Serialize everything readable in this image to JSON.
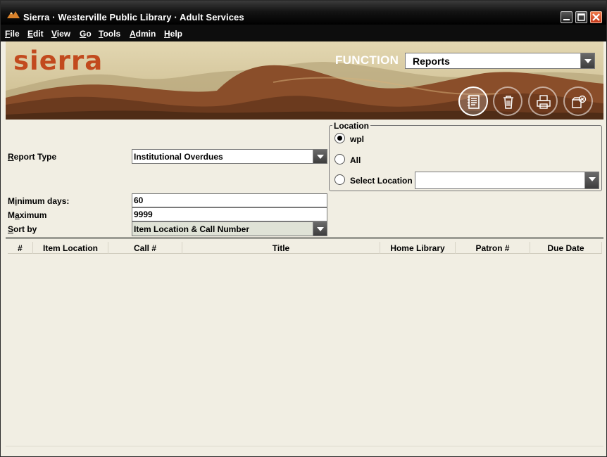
{
  "window": {
    "title": "Sierra · Westerville Public Library · Adult Services"
  },
  "menu": [
    {
      "label": "File",
      "mnemonic": "F",
      "rest": "ile"
    },
    {
      "label": "Edit",
      "mnemonic": "E",
      "rest": "dit"
    },
    {
      "label": "View",
      "mnemonic": "V",
      "rest": "iew"
    },
    {
      "label": "Go",
      "mnemonic": "G",
      "rest": "o"
    },
    {
      "label": "Tools",
      "mnemonic": "T",
      "rest": "ools"
    },
    {
      "label": "Admin",
      "mnemonic": "A",
      "rest": "dmin"
    },
    {
      "label": "Help",
      "mnemonic": "H",
      "rest": "elp"
    }
  ],
  "banner": {
    "logo": "sierra",
    "function_label": "FUNCTION",
    "function_value": "Reports",
    "tools": [
      "report-icon",
      "trash-icon",
      "print-icon",
      "close-record-icon"
    ]
  },
  "form": {
    "report_type": {
      "mnemonic": "R",
      "rest": "eport Type",
      "value": "Institutional Overdues"
    },
    "minimum_days": {
      "pre": "M",
      "mnemonic": "i",
      "rest": "nimum days:",
      "value": "60"
    },
    "maximum": {
      "pre": "M",
      "mnemonic": "a",
      "rest": "ximum",
      "value": "9999"
    },
    "sort_by": {
      "mnemonic": "S",
      "rest": "ort by",
      "value": "Item Location & Call Number"
    }
  },
  "location": {
    "legend": "Location",
    "options": [
      {
        "label": "wpl",
        "checked": true
      },
      {
        "label": "All",
        "checked": false
      },
      {
        "label": "Select Location",
        "checked": false
      }
    ],
    "select_value": ""
  },
  "table": {
    "columns": [
      "#",
      "Item Location",
      "Call #",
      "Title",
      "Home Library",
      "Patron #",
      "Due Date"
    ],
    "rows": []
  },
  "colors": {
    "logo": "#c24a1e",
    "menubar": "#0d0d0d",
    "panel": "#f1eee3"
  }
}
